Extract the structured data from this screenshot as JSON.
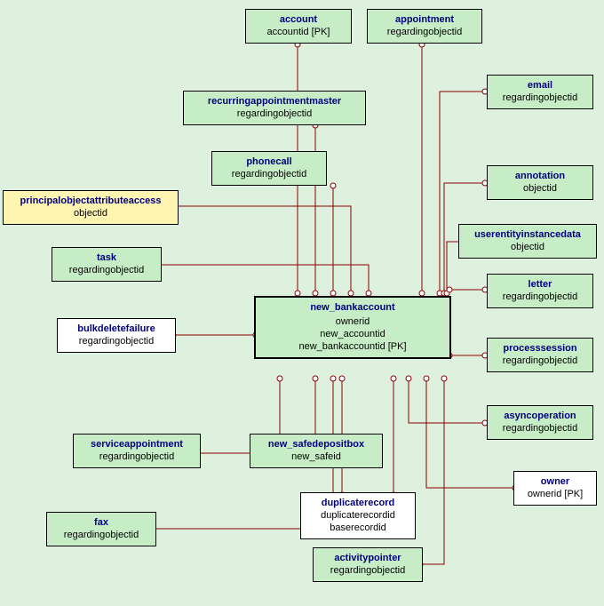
{
  "entities": {
    "account": {
      "name": "account",
      "attrs": [
        "accountid  [PK]"
      ]
    },
    "appointment": {
      "name": "appointment",
      "attrs": [
        "regardingobjectid"
      ]
    },
    "email": {
      "name": "email",
      "attrs": [
        "regardingobjectid"
      ]
    },
    "recurringappointmentmaster": {
      "name": "recurringappointmentmaster",
      "attrs": [
        "regardingobjectid"
      ]
    },
    "phonecall": {
      "name": "phonecall",
      "attrs": [
        "regardingobjectid"
      ]
    },
    "annotation": {
      "name": "annotation",
      "attrs": [
        "objectid"
      ]
    },
    "principalobjectattributeaccess": {
      "name": "principalobjectattributeaccess",
      "attrs": [
        "objectid"
      ]
    },
    "userentityinstancedata": {
      "name": "userentityinstancedata",
      "attrs": [
        "objectid"
      ]
    },
    "task": {
      "name": "task",
      "attrs": [
        "regardingobjectid"
      ]
    },
    "letter": {
      "name": "letter",
      "attrs": [
        "regardingobjectid"
      ]
    },
    "new_bankaccount": {
      "name": "new_bankaccount",
      "attrs": [
        "ownerid",
        "new_accountid",
        "new_bankaccountid  [PK]"
      ]
    },
    "bulkdeletefailure": {
      "name": "bulkdeletefailure",
      "attrs": [
        "regardingobjectid"
      ]
    },
    "processsession": {
      "name": "processsession",
      "attrs": [
        "regardingobjectid"
      ]
    },
    "serviceappointment": {
      "name": "serviceappointment",
      "attrs": [
        "regardingobjectid"
      ]
    },
    "new_safedepositbox": {
      "name": "new_safedepositbox",
      "attrs": [
        "new_safeid"
      ]
    },
    "asyncoperation": {
      "name": "asyncoperation",
      "attrs": [
        "regardingobjectid"
      ]
    },
    "owner": {
      "name": "owner",
      "attrs": [
        "ownerid  [PK]"
      ]
    },
    "duplicaterecord": {
      "name": "duplicaterecord",
      "attrs": [
        "duplicaterecordid",
        "baserecordid"
      ]
    },
    "fax": {
      "name": "fax",
      "attrs": [
        "regardingobjectid"
      ]
    },
    "activitypointer": {
      "name": "activitypointer",
      "attrs": [
        "regardingobjectid"
      ]
    }
  },
  "relationships": [
    {
      "from": "new_bankaccount",
      "to": "account"
    },
    {
      "from": "new_bankaccount",
      "to": "appointment"
    },
    {
      "from": "new_bankaccount",
      "to": "email"
    },
    {
      "from": "new_bankaccount",
      "to": "recurringappointmentmaster"
    },
    {
      "from": "new_bankaccount",
      "to": "phonecall"
    },
    {
      "from": "new_bankaccount",
      "to": "annotation"
    },
    {
      "from": "new_bankaccount",
      "to": "principalobjectattributeaccess"
    },
    {
      "from": "new_bankaccount",
      "to": "userentityinstancedata"
    },
    {
      "from": "new_bankaccount",
      "to": "task"
    },
    {
      "from": "new_bankaccount",
      "to": "letter"
    },
    {
      "from": "new_bankaccount",
      "to": "bulkdeletefailure"
    },
    {
      "from": "new_bankaccount",
      "to": "processsession"
    },
    {
      "from": "new_bankaccount",
      "to": "serviceappointment"
    },
    {
      "from": "new_bankaccount",
      "to": "new_safedepositbox"
    },
    {
      "from": "new_bankaccount",
      "to": "asyncoperation"
    },
    {
      "from": "new_bankaccount",
      "to": "owner"
    },
    {
      "from": "new_bankaccount",
      "to": "duplicaterecord"
    },
    {
      "from": "new_bankaccount",
      "to": "fax"
    },
    {
      "from": "new_bankaccount",
      "to": "activitypointer"
    }
  ]
}
